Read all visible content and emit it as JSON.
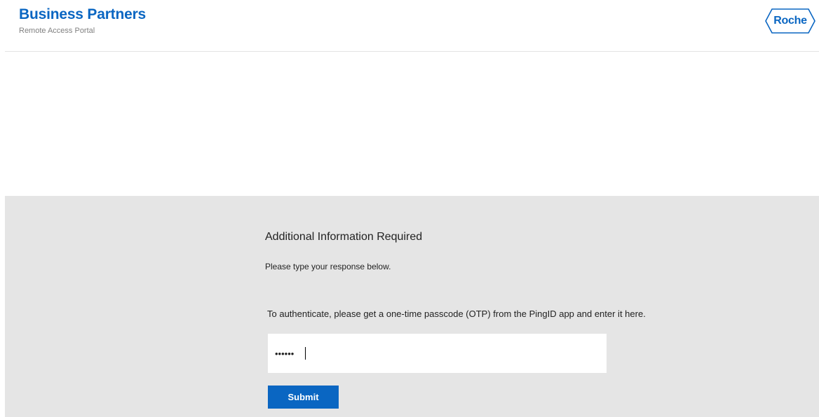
{
  "header": {
    "title": "Business Partners",
    "subtitle": "Remote Access Portal",
    "logo_text": "Roche"
  },
  "form": {
    "heading": "Additional Information Required",
    "subheading": "Please type your response below.",
    "prompt": "To authenticate, please get a one-time passcode (OTP) from the PingID app and enter it here.",
    "otp_value": "••••••",
    "submit_label": "Submit"
  },
  "colors": {
    "brand_blue": "#0a66c2",
    "panel_gray": "#e5e5e5"
  }
}
